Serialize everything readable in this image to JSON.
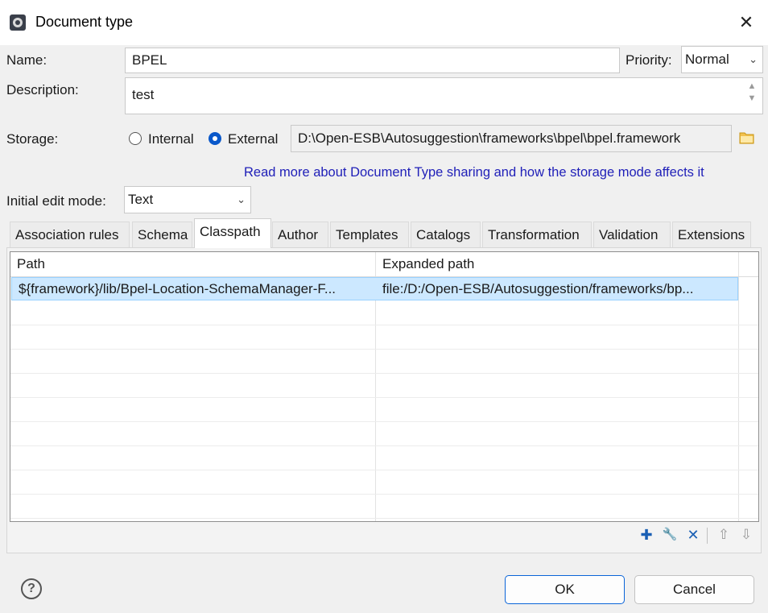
{
  "window": {
    "title": "Document type",
    "icon": "gear-icon",
    "close_glyph": "✕"
  },
  "form": {
    "name_label": "Name:",
    "name_value": "BPEL",
    "priority_label": "Priority:",
    "priority_value": "Normal",
    "description_label": "Description:",
    "description_value": "test",
    "storage_label": "Storage:",
    "storage_options": [
      "Internal",
      "External"
    ],
    "storage_selected": "External",
    "storage_path": "D:\\Open-ESB\\Autosuggestion\\frameworks\\bpel\\bpel.framework",
    "storage_link": "Read more about Document Type sharing and how the storage mode affects it",
    "edit_mode_label": "Initial edit mode:",
    "edit_mode_value": "Text"
  },
  "tabs": [
    "Association rules",
    "Schema",
    "Classpath",
    "Author",
    "Templates",
    "Catalogs",
    "Transformation",
    "Validation",
    "Extensions"
  ],
  "active_tab": "Classpath",
  "table": {
    "columns": [
      "Path",
      "Expanded path"
    ],
    "rows": [
      [
        "${framework}/lib/Bpel-Location-SchemaManager-F...",
        "file:/D:/Open-ESB/Autosuggestion/frameworks/bp..."
      ]
    ]
  },
  "toolbar": {
    "add": "✚",
    "edit": "🔧",
    "remove": "✕",
    "up": "⇧",
    "down": "⇩"
  },
  "buttons": {
    "help": "?",
    "ok": "OK",
    "cancel": "Cancel"
  },
  "colors": {
    "accent": "#0a64d8",
    "link": "#1f1fb8",
    "selection": "#cce8ff"
  }
}
